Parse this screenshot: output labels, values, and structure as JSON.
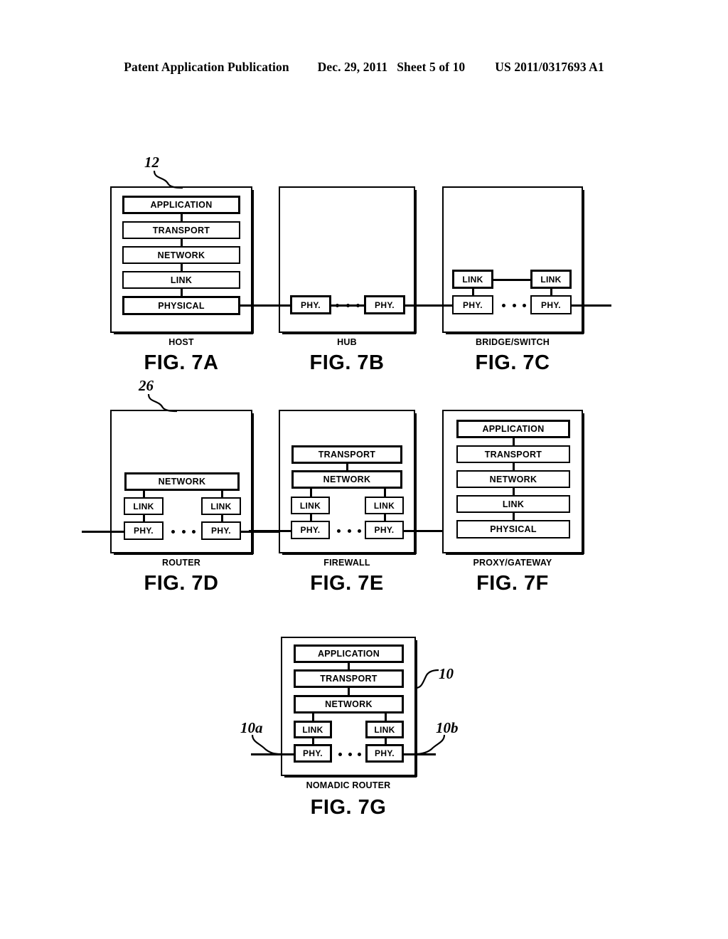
{
  "header": {
    "publication": "Patent Application Publication",
    "date": "Dec. 29, 2011",
    "sheet": "Sheet 5 of 10",
    "number": "US 2011/0317693 A1"
  },
  "figures": [
    {
      "id": "7a",
      "caption": "FIG. 7A",
      "device_name": "HOST",
      "reference_numeral": "12",
      "layers": [
        "APPLICATION",
        "TRANSPORT",
        "NETWORK",
        "LINK",
        "PHYSICAL"
      ]
    },
    {
      "id": "7b",
      "caption": "FIG. 7B",
      "device_name": "HUB",
      "reference_numeral": "",
      "layers": [
        "PHY.",
        "PHY."
      ]
    },
    {
      "id": "7c",
      "caption": "FIG. 7C",
      "device_name": "BRIDGE/SWITCH",
      "reference_numeral": "",
      "layers": [
        "LINK",
        "LINK",
        "PHY.",
        "PHY."
      ]
    },
    {
      "id": "7d",
      "caption": "FIG. 7D",
      "device_name": "ROUTER",
      "reference_numeral": "26",
      "layers": [
        "NETWORK",
        "LINK",
        "LINK",
        "PHY.",
        "PHY."
      ]
    },
    {
      "id": "7e",
      "caption": "FIG. 7E",
      "device_name": "FIREWALL",
      "reference_numeral": "",
      "layers": [
        "TRANSPORT",
        "NETWORK",
        "LINK",
        "LINK",
        "PHY.",
        "PHY."
      ]
    },
    {
      "id": "7f",
      "caption": "FIG. 7F",
      "device_name": "PROXY/GATEWAY",
      "reference_numeral": "",
      "layers": [
        "APPLICATION",
        "TRANSPORT",
        "NETWORK",
        "LINK",
        "PHYSICAL"
      ]
    },
    {
      "id": "7g",
      "caption": "FIG. 7G",
      "device_name": "NOMADIC ROUTER",
      "reference_numeral": "10",
      "reference_numeral_left_port": "10a",
      "reference_numeral_right_port": "10b",
      "layers": [
        "APPLICATION",
        "TRANSPORT",
        "NETWORK",
        "LINK",
        "LINK",
        "PHY.",
        "PHY."
      ]
    }
  ],
  "labels": {
    "application": "APPLICATION",
    "transport": "TRANSPORT",
    "network": "NETWORK",
    "link": "LINK",
    "physical": "PHYSICAL",
    "phy": "PHY."
  },
  "colors": {
    "ink": "#000000",
    "paper": "#ffffff"
  }
}
